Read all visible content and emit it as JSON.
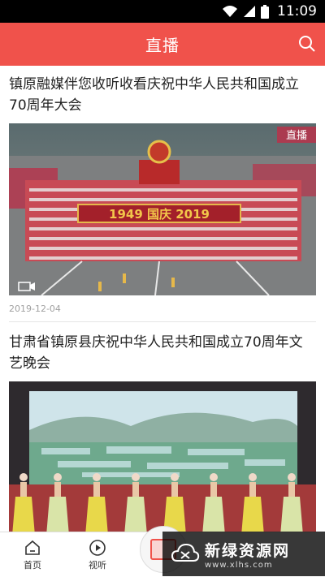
{
  "status_bar": {
    "time": "11:09"
  },
  "header": {
    "title": "直播"
  },
  "feed": [
    {
      "title": "镇原融媒伴您收听收看庆祝中华人民共和国成立70周年大会",
      "date": "2019-12-04",
      "image": {
        "overlay_text": "1949 国庆 2019",
        "corner_badge": "直播"
      }
    },
    {
      "title": "甘肃省镇原县庆祝中华人民共和国成立70周年文艺晚会"
    }
  ],
  "tabbar": {
    "items": [
      {
        "label": "首页",
        "icon": "home-icon"
      },
      {
        "label": "视听",
        "icon": "play-icon"
      },
      {
        "label": "",
        "icon": "tv-icon"
      }
    ]
  },
  "watermark": {
    "name": "新绿资源网",
    "url": "www.xlhs.com"
  },
  "colors": {
    "brand": "#f0524b"
  }
}
